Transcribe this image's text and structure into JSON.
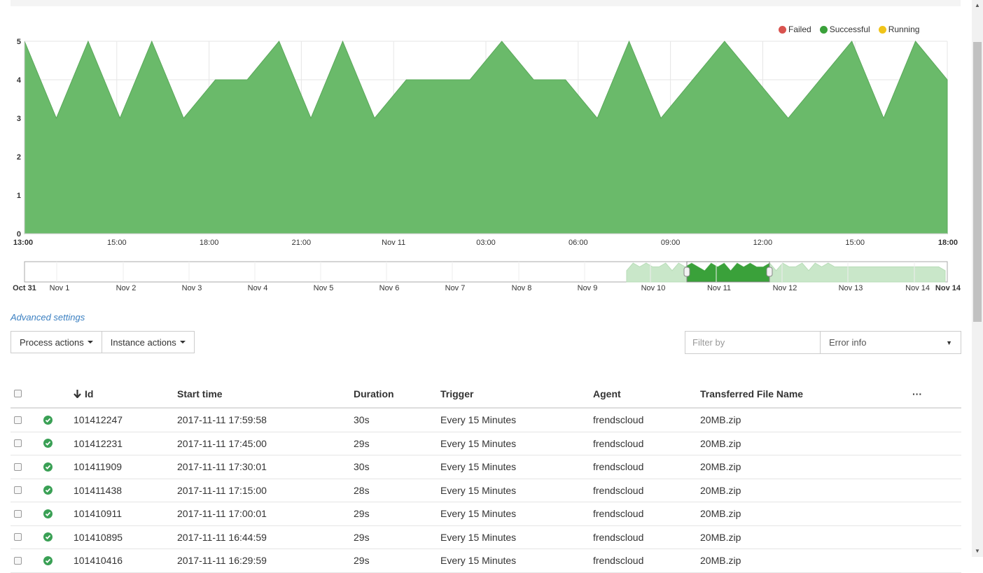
{
  "legend": [
    {
      "label": "Failed",
      "color": "#d9534f"
    },
    {
      "label": "Successful",
      "color": "#3aa13a"
    },
    {
      "label": "Running",
      "color": "#f0c419"
    }
  ],
  "chart_data": {
    "type": "area",
    "series": [
      {
        "name": "Successful",
        "color": "#6aba6a",
        "x": [
          0,
          1,
          2,
          3,
          4,
          5,
          6,
          7,
          8,
          9,
          10,
          11,
          12,
          13,
          14,
          15,
          16,
          17,
          18,
          19,
          20,
          21,
          22,
          23,
          24,
          25,
          26,
          27,
          28,
          29
        ],
        "values": [
          5,
          3,
          5,
          3,
          5,
          3,
          4,
          4,
          5,
          3,
          5,
          3,
          4,
          4,
          4,
          5,
          4,
          4,
          3,
          5,
          3,
          4,
          5,
          4,
          3,
          4,
          5,
          3,
          5,
          4
        ]
      }
    ],
    "ylim": [
      0,
      5
    ],
    "yticks": [
      "0",
      "1",
      "2",
      "3",
      "4",
      "5"
    ],
    "xticks": [
      {
        "label": "13:00",
        "bold": true
      },
      {
        "label": "15:00",
        "bold": false
      },
      {
        "label": "18:00",
        "bold": false
      },
      {
        "label": "21:00",
        "bold": false
      },
      {
        "label": "Nov 11",
        "bold": false
      },
      {
        "label": "03:00",
        "bold": false
      },
      {
        "label": "06:00",
        "bold": false
      },
      {
        "label": "09:00",
        "bold": false
      },
      {
        "label": "12:00",
        "bold": false
      },
      {
        "label": "15:00",
        "bold": false
      },
      {
        "label": "18:00",
        "bold": true
      }
    ],
    "grid": true
  },
  "navigator": {
    "labels": [
      {
        "label": "Oct 31",
        "bold": true
      },
      {
        "label": "Nov 1",
        "bold": false
      },
      {
        "label": "Nov 2",
        "bold": false
      },
      {
        "label": "Nov 3",
        "bold": false
      },
      {
        "label": "Nov 4",
        "bold": false
      },
      {
        "label": "Nov 5",
        "bold": false
      },
      {
        "label": "Nov 6",
        "bold": false
      },
      {
        "label": "Nov 7",
        "bold": false
      },
      {
        "label": "Nov 8",
        "bold": false
      },
      {
        "label": "Nov 9",
        "bold": false
      },
      {
        "label": "Nov 10",
        "bold": false
      },
      {
        "label": "Nov 11",
        "bold": false
      },
      {
        "label": "Nov 12",
        "bold": false
      },
      {
        "label": "Nov 13",
        "bold": false
      },
      {
        "label": "Nov 14",
        "bold": false
      },
      {
        "label": "Nov 14",
        "bold": true
      }
    ]
  },
  "advanced_settings": "Advanced settings",
  "toolbar": {
    "process_actions": "Process actions",
    "instance_actions": "Instance actions",
    "filter_placeholder": "Filter by",
    "error_info": "Error info"
  },
  "table": {
    "columns": {
      "id": "Id",
      "start_time": "Start time",
      "duration": "Duration",
      "trigger": "Trigger",
      "agent": "Agent",
      "file_name": "Transferred File Name",
      "more": "···"
    },
    "rows": [
      {
        "id": "101412247",
        "start_time": "2017-11-11 17:59:58",
        "duration": "30s",
        "trigger": "Every 15 Minutes",
        "agent": "frendscloud",
        "file_name": "20MB.zip"
      },
      {
        "id": "101412231",
        "start_time": "2017-11-11 17:45:00",
        "duration": "29s",
        "trigger": "Every 15 Minutes",
        "agent": "frendscloud",
        "file_name": "20MB.zip"
      },
      {
        "id": "101411909",
        "start_time": "2017-11-11 17:30:01",
        "duration": "30s",
        "trigger": "Every 15 Minutes",
        "agent": "frendscloud",
        "file_name": "20MB.zip"
      },
      {
        "id": "101411438",
        "start_time": "2017-11-11 17:15:00",
        "duration": "28s",
        "trigger": "Every 15 Minutes",
        "agent": "frendscloud",
        "file_name": "20MB.zip"
      },
      {
        "id": "101410911",
        "start_time": "2017-11-11 17:00:01",
        "duration": "29s",
        "trigger": "Every 15 Minutes",
        "agent": "frendscloud",
        "file_name": "20MB.zip"
      },
      {
        "id": "101410895",
        "start_time": "2017-11-11 16:44:59",
        "duration": "29s",
        "trigger": "Every 15 Minutes",
        "agent": "frendscloud",
        "file_name": "20MB.zip"
      },
      {
        "id": "101410416",
        "start_time": "2017-11-11 16:29:59",
        "duration": "29s",
        "trigger": "Every 15 Minutes",
        "agent": "frendscloud",
        "file_name": "20MB.zip"
      }
    ]
  }
}
